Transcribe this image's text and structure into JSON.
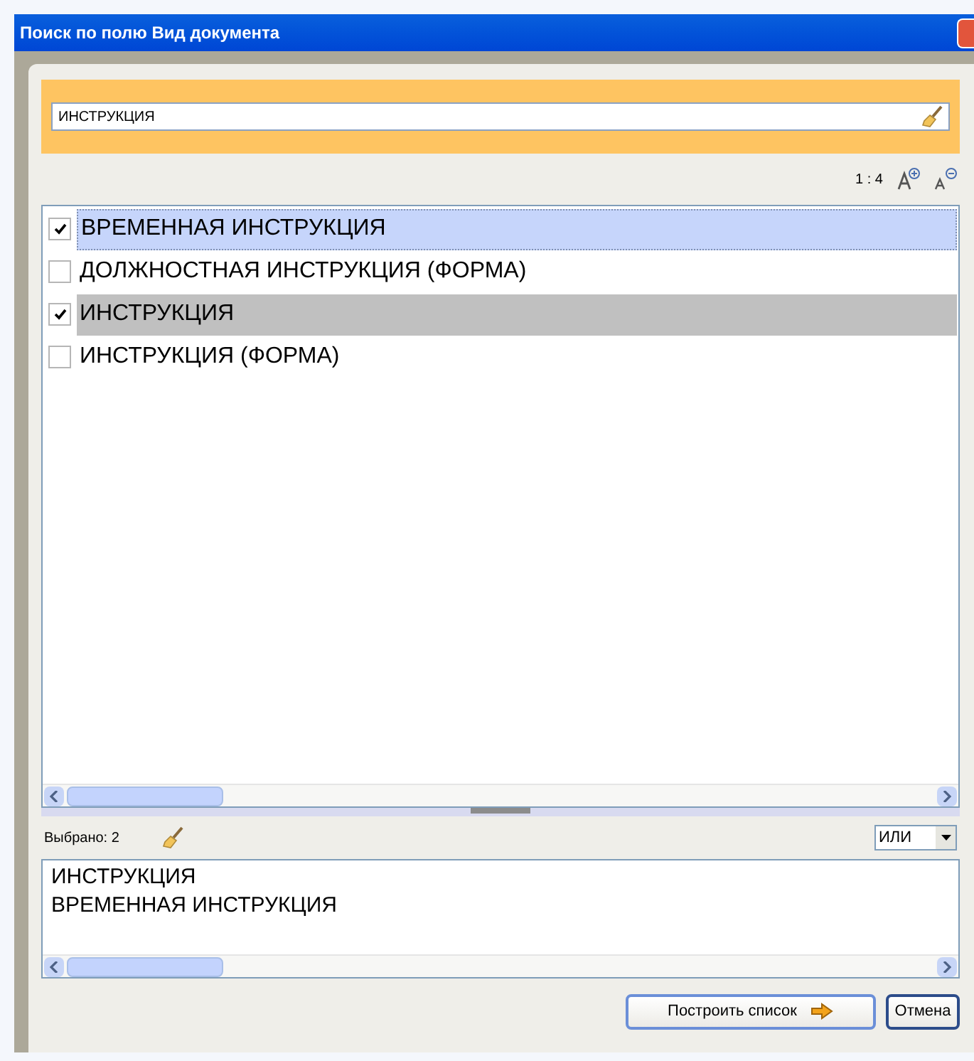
{
  "window": {
    "title": "Поиск по полю Вид документа"
  },
  "search": {
    "value": "ИНСТРУКЦИЯ"
  },
  "zoom": {
    "ratio": "1 : 4"
  },
  "items": [
    {
      "label": "ВРЕМЕННАЯ ИНСТРУКЦИЯ",
      "checked": true,
      "selected": false,
      "focused": true
    },
    {
      "label": "ДОЛЖНОСТНАЯ ИНСТРУКЦИЯ (ФОРМА)",
      "checked": false,
      "selected": false,
      "focused": false
    },
    {
      "label": "ИНСТРУКЦИЯ",
      "checked": true,
      "selected": true,
      "focused": false
    },
    {
      "label": "ИНСТРУКЦИЯ (ФОРМА)",
      "checked": false,
      "selected": false,
      "focused": false
    }
  ],
  "selection": {
    "count_label": "Выбрано: 2",
    "mode": "ИЛИ",
    "lines": [
      "ИНСТРУКЦИЯ",
      "ВРЕМЕННАЯ ИНСТРУКЦИЯ"
    ]
  },
  "buttons": [
    {
      "label": "Построить список",
      "kind": "primary"
    },
    {
      "label": "Отмена",
      "kind": "plain"
    }
  ]
}
